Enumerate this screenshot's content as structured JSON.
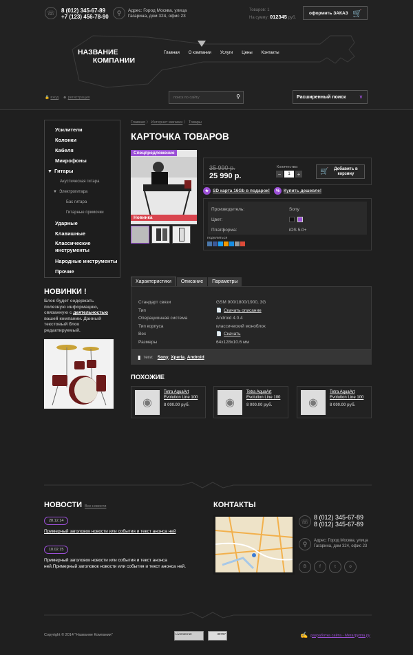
{
  "header": {
    "phone1": "8 (012) 345-67-89",
    "phone2": "+7 (123) 456-78-90",
    "address": "Адрес: Город Москва, улица Гагарина, дом 324, офис 23",
    "cart_items_label": "Товаров:",
    "cart_items_value": "1",
    "cart_sum_label": "На сумму:",
    "cart_sum_value": "012345",
    "cart_currency": "руб.",
    "order_button": "оформить ЗАКАЗ",
    "logo_line1": "НАЗВАНИЕ",
    "logo_line2": "КОМПАНИИ",
    "nav": [
      "Главная",
      "О компании",
      "Услуги",
      "Цены",
      "Контакты"
    ],
    "login": "вход",
    "register": "регистрация",
    "search_placeholder": "поиск по сайту",
    "advanced_search": "Расширенный поиск"
  },
  "sidebar": {
    "items": [
      {
        "label": "Усилители",
        "level": 0
      },
      {
        "label": "Колонки",
        "level": 0
      },
      {
        "label": "Кабеля",
        "level": 0
      },
      {
        "label": "Микрофоны",
        "level": 0
      },
      {
        "label": "Гитары",
        "level": 0,
        "open": true
      },
      {
        "label": "Акустическая гитара",
        "level": 1
      },
      {
        "label": "Электрогитара",
        "level": 1,
        "open": true
      },
      {
        "label": "Бас гитара",
        "level": 2
      },
      {
        "label": "Гитарные примочки",
        "level": 2
      },
      {
        "label": "Ударные",
        "level": 0
      },
      {
        "label": "Клавишные",
        "level": 0
      },
      {
        "label": "Классические инструменты",
        "level": 0
      },
      {
        "label": "Народные инструменты",
        "level": 0
      },
      {
        "label": "Прочие",
        "level": 0
      }
    ],
    "news_title": "НОВИНКИ !",
    "news_text_a": "Блок будет содержать полезную информацию, связанную с",
    "news_text_link": "деятельностью",
    "news_text_b": "вашей компании. Данный текстовый блок редактируемый."
  },
  "breadcrumb": [
    "Главная",
    "Интернет магазин",
    "Товары"
  ],
  "product": {
    "page_title": "КАРТОЧКА ТОВАРОВ",
    "badge_special": "Спецпредложение",
    "badge_new": "Новинка",
    "old_price": "35 990 р.",
    "price": "25 990 р.",
    "qty_label": "Количество:",
    "qty_value": "1",
    "add_to_cart": "Добавить в корзину",
    "gift": "SD карта 16Gb в подарок!",
    "cheaper": "Купить дешевле!",
    "props": [
      {
        "k": "Производитель:",
        "v": "Sony"
      },
      {
        "k": "Цвет:",
        "v": ""
      },
      {
        "k": "Платформа:",
        "v": "iOS 5.0+"
      }
    ],
    "share_label": "поделиться"
  },
  "tabs": [
    "Характеристики",
    "Описание",
    "Параметры"
  ],
  "specs": [
    {
      "k": "Стандарт связи",
      "v": "GSM 900/1800/1900, 3G"
    },
    {
      "k": "Тип",
      "v": "Скачать описание",
      "link": true
    },
    {
      "k": "Операционная система",
      "v": "Android 4.0.4"
    },
    {
      "k": "Тип корпуса",
      "v": "классический моноблок"
    },
    {
      "k": "Вес",
      "v": "Скачать",
      "link": true
    },
    {
      "k": "Размеры",
      "v": "64x128x10.6 мм"
    }
  ],
  "tags": {
    "label": "теги:",
    "items": [
      "Sony",
      "Xperia",
      "Android"
    ]
  },
  "similar": {
    "title": "ПОХОЖИЕ",
    "items": [
      {
        "name": "Tetra AquaArt Evolution Line 100",
        "price": "8 000.00 руб."
      },
      {
        "name": "Tetra AquaArt Evolution Line 100",
        "price": "8 000.00 руб."
      },
      {
        "name": "Tetra AquaArt Evolution Line 100",
        "price": "8 000.00 руб."
      }
    ]
  },
  "news": {
    "title": "НОВОСТИ",
    "all_link": "Все новости",
    "items": [
      {
        "date": "28.12.14",
        "text": "Примерный заголовок новости или события и текст анонса  ней",
        "underline": true
      },
      {
        "date": "10.02.15",
        "text": "Примерный заголовок новости или события и текст анонса ней.Примерный заголовок новости или события и текст анонса  ней.",
        "underline": false
      }
    ]
  },
  "contacts": {
    "title": "КОНТАКТЫ",
    "phone1": "8 (012) 345-67-89",
    "phone2": "8 (012) 345-67-89",
    "address": "Адрес: Город Москва, улица Гагарина, дом 324, офис 23"
  },
  "footer": {
    "copyright": "Copyright © 2014 \"Название Компании\"",
    "counter1": "LiveInternet",
    "counter2": "39797",
    "dev_label": "разработка сайта - Мегагруппа.ру"
  },
  "colors": {
    "accent": "#9b4fd6",
    "badge_red": "#d9454f",
    "bg": "#1f1f1f"
  }
}
